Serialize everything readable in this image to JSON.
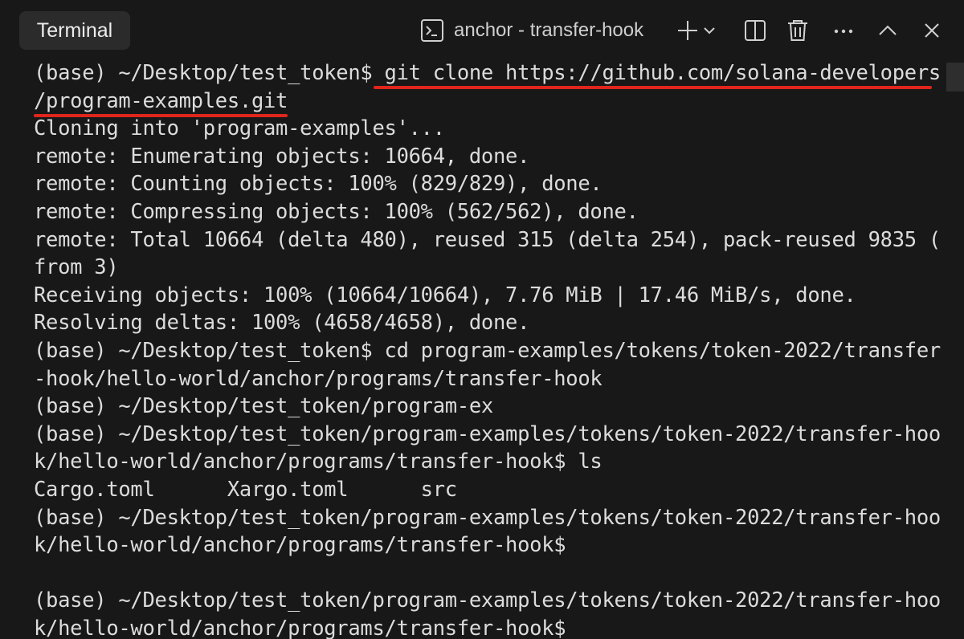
{
  "header": {
    "tab_label": "Terminal",
    "terminal_title": "anchor - transfer-hook",
    "icons": [
      "terminal-prompt-icon",
      "plus-icon",
      "chevron-down-icon",
      "split-panel-icon",
      "trash-icon",
      "more-icon",
      "chevron-up-icon",
      "close-icon"
    ]
  },
  "terminal": {
    "lines": [
      "(base) ~/Desktop/test_token$ git clone https://github.com/solana-developers",
      "/program-examples.git",
      "Cloning into 'program-examples'...",
      "remote: Enumerating objects: 10664, done.",
      "remote: Counting objects: 100% (829/829), done.",
      "remote: Compressing objects: 100% (562/562), done.",
      "remote: Total 10664 (delta 480), reused 315 (delta 254), pack-reused 9835 (",
      "from 3)",
      "Receiving objects: 100% (10664/10664), 7.76 MiB | 17.46 MiB/s, done.",
      "Resolving deltas: 100% (4658/4658), done.",
      "(base) ~/Desktop/test_token$ cd program-examples/tokens/token-2022/transfer",
      "-hook/hello-world/anchor/programs/transfer-hook",
      "(base) ~/Desktop/test_token/program-ex",
      "(base) ~/Desktop/test_token/program-examples/tokens/token-2022/transfer-hoo",
      "k/hello-world/anchor/programs/transfer-hook$ ls",
      "Cargo.toml      Xargo.toml      src",
      "(base) ~/Desktop/test_token/program-examples/tokens/token-2022/transfer-hoo",
      "k/hello-world/anchor/programs/transfer-hook$",
      "",
      "(base) ~/Desktop/test_token/program-examples/tokens/token-2022/transfer-hoo",
      "k/hello-world/anchor/programs/transfer-hook$"
    ]
  },
  "colors": {
    "background": "#181818",
    "text": "#dcdcdc",
    "highlight_underline": "#e0251b",
    "tab_background": "#2b2b2b"
  }
}
